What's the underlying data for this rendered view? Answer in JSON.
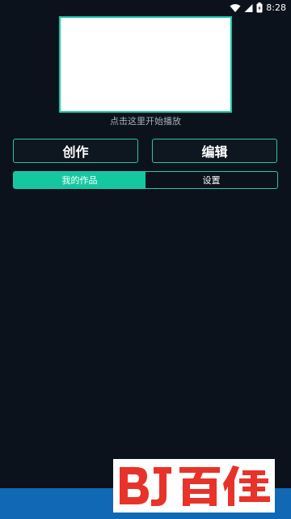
{
  "status_bar": {
    "time": "8:28",
    "icons": [
      "wifi-icon",
      "signal-icon",
      "battery-icon"
    ]
  },
  "player": {
    "hint": "点击这里开始播放"
  },
  "actions": {
    "create_label": "创作",
    "edit_label": "编辑"
  },
  "tabs": [
    {
      "label": "我的作品",
      "active": true
    },
    {
      "label": "设置",
      "active": false
    }
  ],
  "colors": {
    "background": "#0c121b",
    "accent": "#15c7a1",
    "bottom_bar": "#1168b5"
  }
}
